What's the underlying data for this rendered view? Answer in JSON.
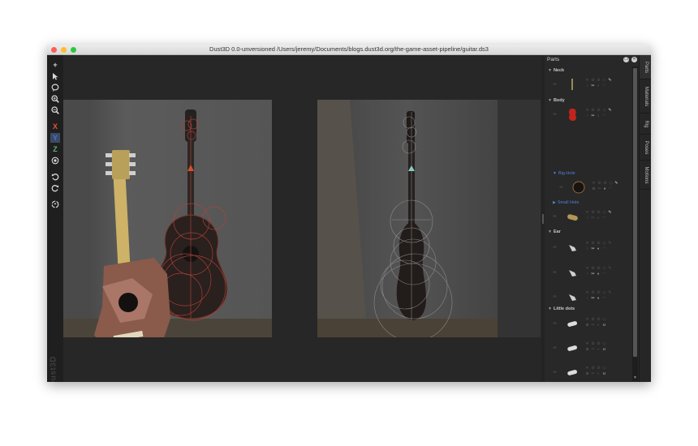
{
  "window": {
    "title": "Dust3D 0.0-unversioned /Users/jeremy/Documents/blogs.dust3d.org/the-game-asset-pipeline/guitar.ds3"
  },
  "toolbar": {
    "add_glyph": "+",
    "axis_x": "X",
    "axis_y": "Y",
    "axis_z": "Z"
  },
  "logo": "Dust3D",
  "parts_panel": {
    "title": "Parts",
    "groups": {
      "neck": "Neck",
      "body": "Body",
      "big_hole": "Big Hole",
      "small_hole": "Small Hole",
      "ear": "Ear",
      "little_dots": "Little dots"
    }
  },
  "side_tabs": [
    "Parts",
    "Materials",
    "Rig",
    "Poses",
    "Motions"
  ],
  "colors": {
    "accent_blue": "#4a82d6",
    "window_bg": "#252525",
    "body_part_red": "#c0241c"
  }
}
